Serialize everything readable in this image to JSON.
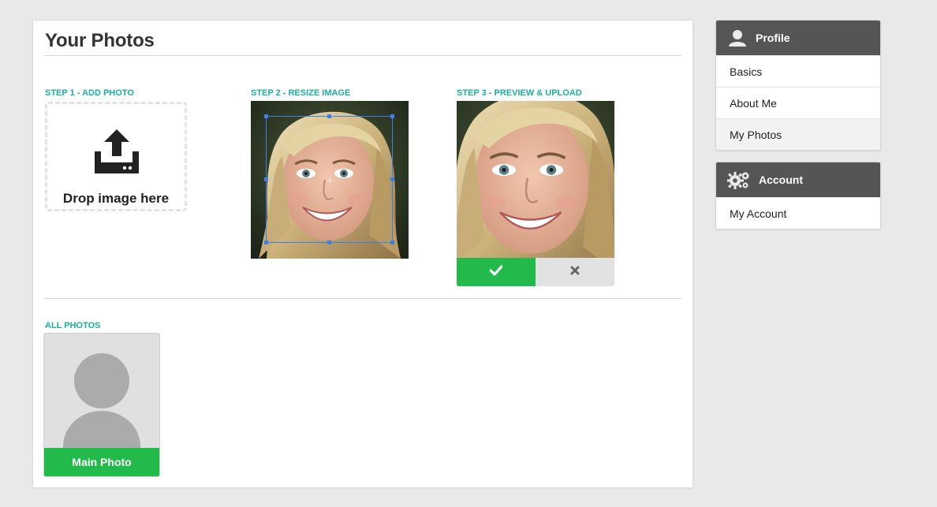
{
  "page": {
    "title": "Your Photos"
  },
  "steps": {
    "add": {
      "label": "STEP 1 - ADD PHOTO",
      "drop_text": "Drop image here",
      "icon": "upload-icon"
    },
    "resize": {
      "label": "STEP 2 - RESIZE IMAGE"
    },
    "preview": {
      "label": "STEP 3 - PREVIEW & UPLOAD",
      "confirm_icon": "check-icon",
      "cancel_icon": "close-icon"
    }
  },
  "gallery": {
    "label": "ALL PHOTOS",
    "photos": [
      {
        "caption": "Main Photo"
      }
    ]
  },
  "sidebar": {
    "profile": {
      "title": "Profile",
      "icon": "user-icon",
      "items": [
        {
          "label": "Basics",
          "active": false
        },
        {
          "label": "About Me",
          "active": false
        },
        {
          "label": "My Photos",
          "active": true
        }
      ]
    },
    "account": {
      "title": "Account",
      "icon": "gears-icon",
      "items": [
        {
          "label": "My Account",
          "active": false
        }
      ]
    }
  },
  "colors": {
    "accent_teal": "#1ab0a0",
    "success_green": "#22bb4b",
    "crop_blue": "#3d7fe6",
    "sidebar_header": "#555555",
    "page_bg": "#e9e9e9"
  }
}
